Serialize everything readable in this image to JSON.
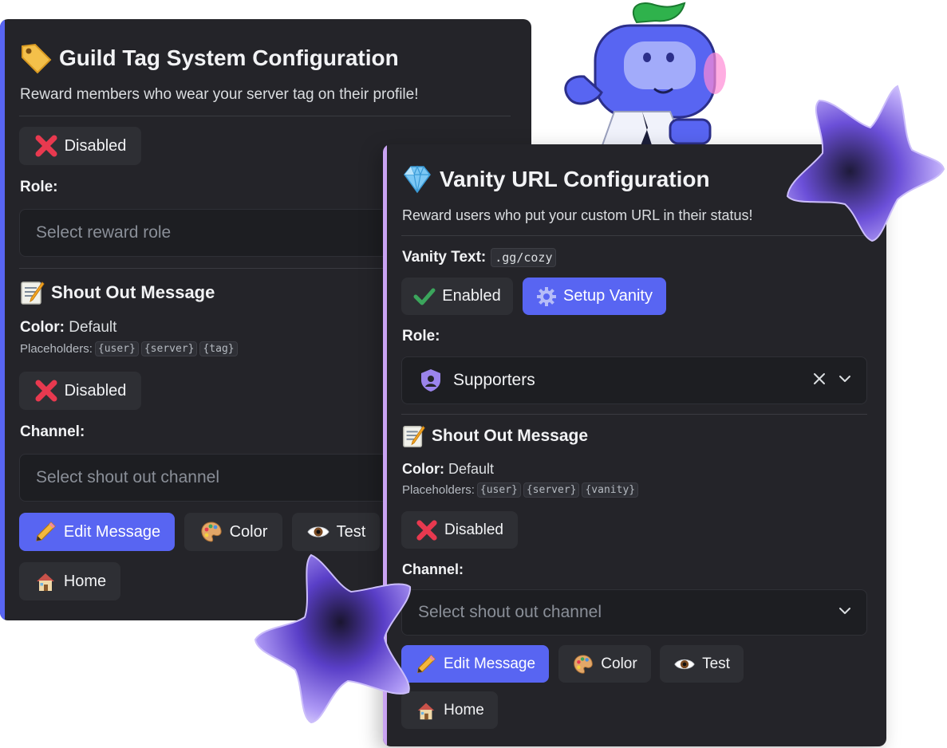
{
  "guild": {
    "title": "Guild Tag System Configuration",
    "title_icon": "label-tag-icon",
    "description": "Reward members who wear your server tag on their profile!",
    "status_button": "Disabled",
    "role_label": "Role:",
    "role_placeholder": "Select reward role",
    "shout_title": "Shout Out Message",
    "color_label": "Color:",
    "color_value": "Default",
    "placeholders_label": "Placeholders:",
    "placeholders": [
      "{user}",
      "{server}",
      "{tag}"
    ],
    "shout_status_button": "Disabled",
    "channel_label": "Channel:",
    "channel_placeholder": "Select shout out channel",
    "edit_button": "Edit Message",
    "color_button": "Color",
    "test_button": "Test",
    "home_button": "Home"
  },
  "vanity": {
    "title": "Vanity URL Configuration",
    "title_icon": "gem-icon",
    "description": "Reward users who put your custom URL in their status!",
    "vanity_text_label": "Vanity Text:",
    "vanity_text_value": ".gg/cozy",
    "status_button": "Enabled",
    "setup_button": "Setup Vanity",
    "role_label": "Role:",
    "role_value": "Supporters",
    "shout_title": "Shout Out Message",
    "color_label": "Color:",
    "color_value": "Default",
    "placeholders_label": "Placeholders:",
    "placeholders": [
      "{user}",
      "{server}",
      "{vanity}"
    ],
    "shout_status_button": "Disabled",
    "channel_label": "Channel:",
    "channel_placeholder": "Select shout out channel",
    "edit_button": "Edit Message",
    "color_button": "Color",
    "test_button": "Test",
    "home_button": "Home"
  },
  "colors": {
    "panel_bg": "#242429",
    "primary_button": "#5865f2",
    "secondary_button": "#2e2f34",
    "guild_accent": "#5865f2",
    "vanity_accent": "#c9a3f2",
    "disabled_red": "#e8394f",
    "enabled_green": "#3ba55c"
  }
}
